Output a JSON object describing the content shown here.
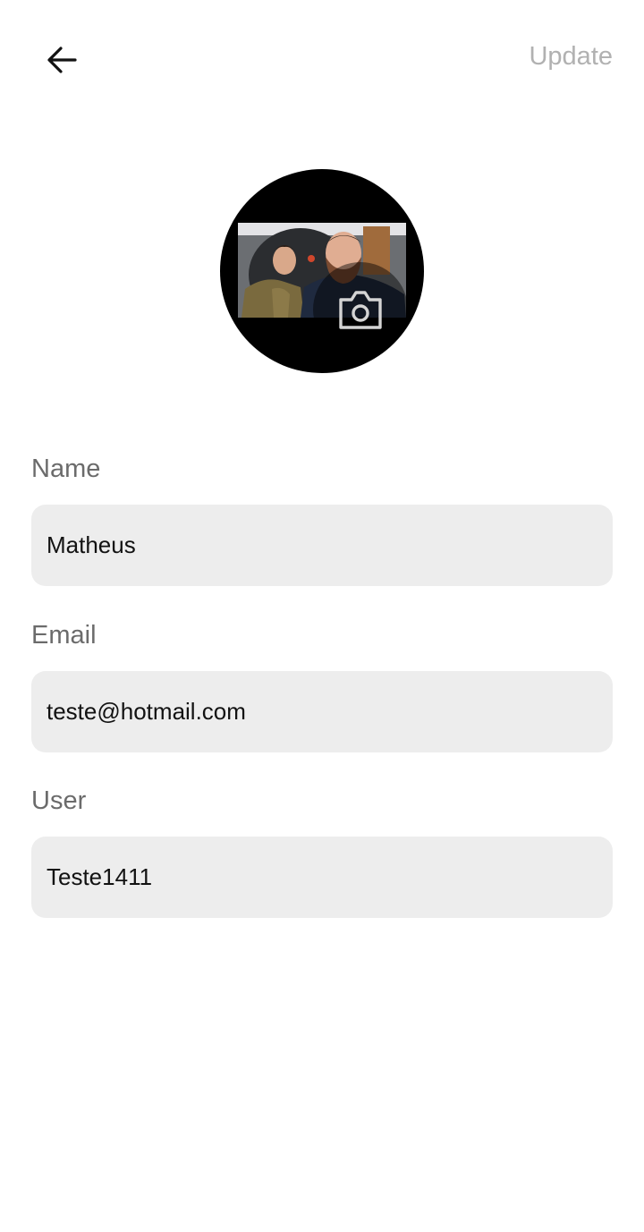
{
  "header": {
    "back_icon": "arrow-left-icon",
    "update_label": "Update",
    "update_color": "#b1b1b1"
  },
  "avatar": {
    "camera_icon": "camera-icon"
  },
  "form": {
    "name": {
      "label": "Name",
      "value": "Matheus"
    },
    "email": {
      "label": "Email",
      "value": "teste@hotmail.com"
    },
    "user": {
      "label": "User",
      "value": "Teste1411"
    }
  },
  "colors": {
    "field_background": "#ededed",
    "label_text": "#6b6b6b",
    "value_text": "#121212"
  }
}
